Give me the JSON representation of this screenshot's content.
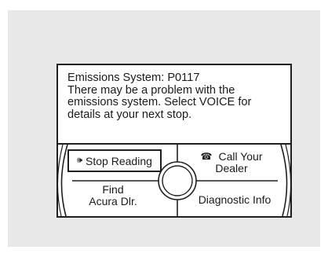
{
  "message": {
    "lines": [
      "Emissions System: P0117",
      "There may be a problem with the",
      "emissions system. Select VOICE for",
      "details at your next stop."
    ]
  },
  "buttons": {
    "stop_reading": "Stop Reading",
    "call_dealer_line1": "Call Your",
    "call_dealer_line2": "Dealer",
    "find_line1": "Find",
    "find_line2": "Acura Dlr.",
    "diagnostic": "Diagnostic Info"
  },
  "icons": {
    "speaker": "speaker-icon",
    "phone": "phone-icon"
  },
  "colors": {
    "panel_background": "#e8e8e8",
    "screen_background": "#ffffff",
    "border": "#1f1f1f"
  }
}
